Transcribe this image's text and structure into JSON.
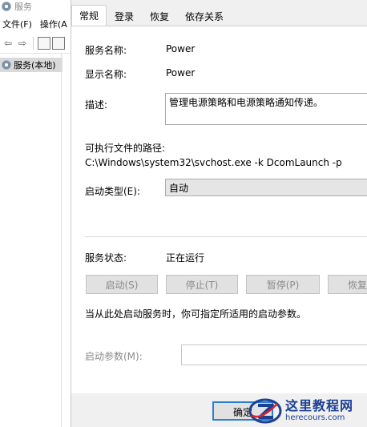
{
  "bg_window": {
    "title": "服务",
    "menu": [
      "文件(F)",
      "操作(A"
    ],
    "tree_item": "服务(本地)"
  },
  "dialog": {
    "tabs": [
      "常规",
      "登录",
      "恢复",
      "依存关系"
    ],
    "active_tab": "常规",
    "service_name_label": "服务名称:",
    "service_name": "Power",
    "display_name_label": "显示名称:",
    "display_name": "Power",
    "description_label": "描述:",
    "description": "管理电源策略和电源策略通知传递。",
    "path_label": "可执行文件的路径:",
    "path": "C:\\Windows\\system32\\svchost.exe -k DcomLaunch -p",
    "startup_type_label": "启动类型(E):",
    "startup_type": "自动",
    "status_label": "服务状态:",
    "status": "正在运行",
    "buttons": {
      "start": "启动(S)",
      "stop": "停止(T)",
      "pause": "暂停(P)",
      "resume": "恢复"
    },
    "hint": "当从此处启动服务时，你可指定所适用的启动参数。",
    "param_label": "启动参数(M):",
    "param_value": "",
    "ok": "确定"
  },
  "watermark": {
    "title": "这里教程网",
    "url": "herecours.com"
  },
  "colors": {
    "accent": "#2a7fd4",
    "watermark_blue": "#1b3f93",
    "watermark_red": "#d8242c"
  }
}
